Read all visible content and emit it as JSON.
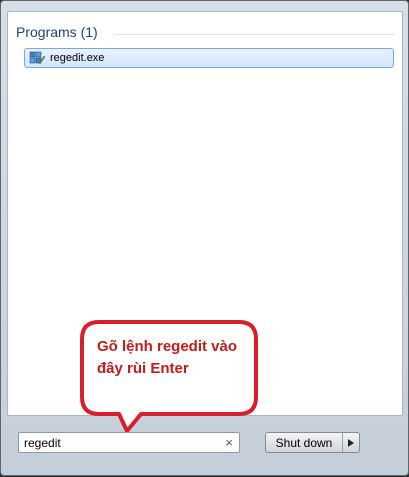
{
  "programs": {
    "header": "Programs (1)",
    "items": [
      {
        "label": "regedit.exe",
        "icon": "regedit-icon"
      }
    ]
  },
  "callout": {
    "text": "Gõ lệnh regedit vào đây rùi Enter",
    "color": "#c41b1b"
  },
  "search": {
    "value": "regedit",
    "clear_glyph": "×"
  },
  "shutdown": {
    "label": "Shut down",
    "arrow_icon": "triangle-right-icon"
  },
  "colors": {
    "header_text": "#1e3f82",
    "selection_border": "#7ba7d9",
    "frame": "#c5ced9"
  }
}
